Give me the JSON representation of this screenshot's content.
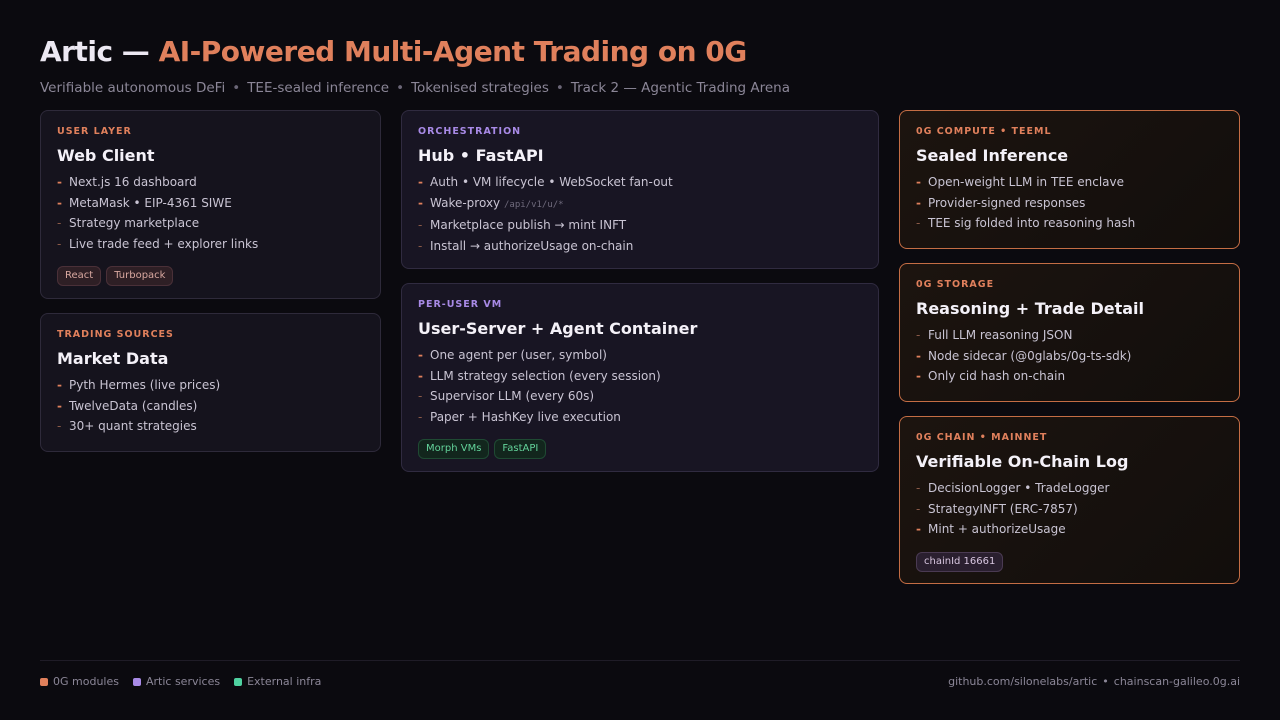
{
  "header": {
    "title_main": "Artic",
    "title_dash": " — ",
    "title_accent": "AI-Powered Multi-Agent Trading on 0G",
    "subtitle": [
      "Verifiable autonomous DeFi",
      "TEE-sealed inference",
      "Tokenised strategies",
      "Track 2 — Agentic Trading Arena"
    ],
    "separator": "•"
  },
  "cards": {
    "user_layer": {
      "kicker": "USER LAYER",
      "title": "Web Client",
      "items": [
        "Next.js 16 dashboard",
        "MetaMask • EIP-4361 SIWE",
        "Strategy marketplace",
        "Live trade feed + explorer links"
      ],
      "tags": [
        "React",
        "Turbopack"
      ]
    },
    "trading_sources": {
      "kicker": "TRADING SOURCES",
      "title": "Market Data",
      "items": [
        "Pyth Hermes (live prices)",
        "TwelveData (candles)",
        "30+ quant strategies"
      ]
    },
    "orchestration": {
      "kicker": "ORCHESTRATION",
      "title": "Hub • FastAPI",
      "items": [
        "Auth • VM lifecycle • WebSocket fan-out",
        "Wake-proxy",
        "Marketplace publish → mint INFT",
        "Install → authorizeUsage on-chain"
      ],
      "code": "/api/v1/u/*"
    },
    "per_user_vm": {
      "kicker": "PER-USER VM",
      "title": "User-Server + Agent Container",
      "items": [
        "One agent per (user, symbol)",
        "LLM strategy selection (every session)",
        "Supervisor LLM (every 60s)",
        "Paper + HashKey live execution"
      ],
      "tags": [
        "Morph VMs",
        "FastAPI"
      ]
    },
    "compute": {
      "kicker": "0G COMPUTE • TEEML",
      "title": "Sealed Inference",
      "items": [
        "Open-weight LLM in TEE enclave",
        "Provider-signed responses",
        "TEE sig folded into reasoning hash"
      ]
    },
    "storage": {
      "kicker": "0G STORAGE",
      "title": "Reasoning + Trade Detail",
      "items": [
        "Full LLM reasoning JSON",
        "Node sidecar (@0glabs/0g-ts-sdk)",
        "Only cid hash on-chain"
      ]
    },
    "chain": {
      "kicker": "0G CHAIN • MAINNET",
      "title": "Verifiable On-Chain Log",
      "items": [
        "DecisionLogger • TradeLogger",
        "StrategyINFT (ERC-7857)",
        "Mint + authorizeUsage"
      ],
      "tags": [
        "chainId 16661"
      ]
    }
  },
  "legend": [
    {
      "label": "0G modules",
      "color": "#e0805c"
    },
    {
      "label": "Artic services",
      "color": "#a88ae6"
    },
    {
      "label": "External infra",
      "color": "#4fd1a0"
    }
  ],
  "footer_links": [
    "github.com/silonelabs/artic",
    "chainscan-galileo.0g.ai"
  ]
}
